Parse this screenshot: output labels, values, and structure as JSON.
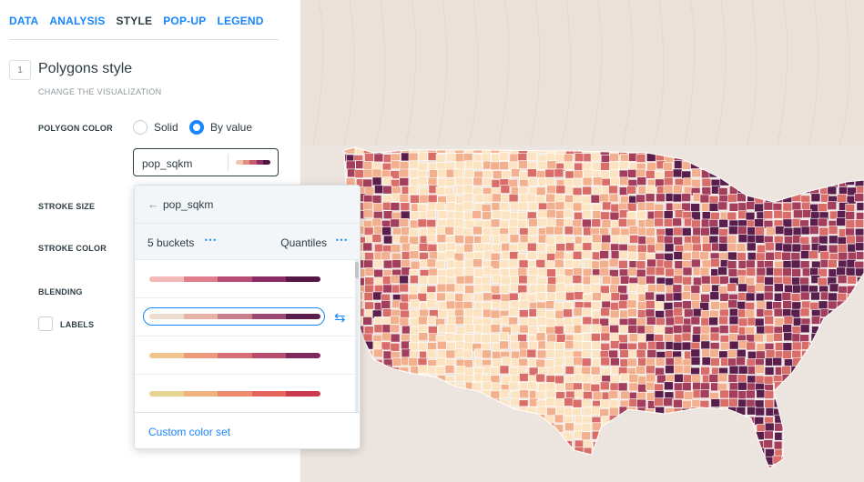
{
  "tabs": [
    "DATA",
    "ANALYSIS",
    "STYLE",
    "POP-UP",
    "LEGEND"
  ],
  "active_tab": "STYLE",
  "section": {
    "number": "1",
    "title": "Polygons style",
    "subtitle": "CHANGE THE VISUALIZATION"
  },
  "polygon_color": {
    "label": "POLYGON COLOR",
    "options": [
      "Solid",
      "By value"
    ],
    "selected": "By value"
  },
  "attribute_select": {
    "value": "pop_sqkm",
    "ramp": [
      "#f2c5b0",
      "#e48e80",
      "#c35a6f",
      "#8e2f63",
      "#4f1540"
    ]
  },
  "stroke_size": {
    "label": "STROKE SIZE"
  },
  "stroke_color": {
    "label": "STROKE COLOR"
  },
  "blending": {
    "label": "BLENDING"
  },
  "labels": {
    "label": "LABELS",
    "checked": false
  },
  "dropdown": {
    "back_label": "pop_sqkm",
    "buckets": "5 buckets",
    "classification": "Quantiles",
    "custom_label": "Custom color set",
    "ramps": [
      [
        "#f3b8b8",
        "#e17e8e",
        "#b94c74",
        "#8a2d65",
        "#561746"
      ],
      [
        "#ecdcd0",
        "#e6b4a4",
        "#c77f8c",
        "#9a4a73",
        "#5a1e4e"
      ],
      [
        "#f1c590",
        "#eb9a7c",
        "#d86d76",
        "#b64d6d",
        "#7f2a5f"
      ],
      [
        "#e8d491",
        "#efb47e",
        "#eb8b6b",
        "#e4645c",
        "#c83a4c"
      ]
    ],
    "selected_ramp": 1
  },
  "map": {
    "palette": [
      "#fce3c1",
      "#f3b08f",
      "#d86d69",
      "#a33f5c",
      "#5a1e4c"
    ],
    "background": "#ece4de"
  }
}
